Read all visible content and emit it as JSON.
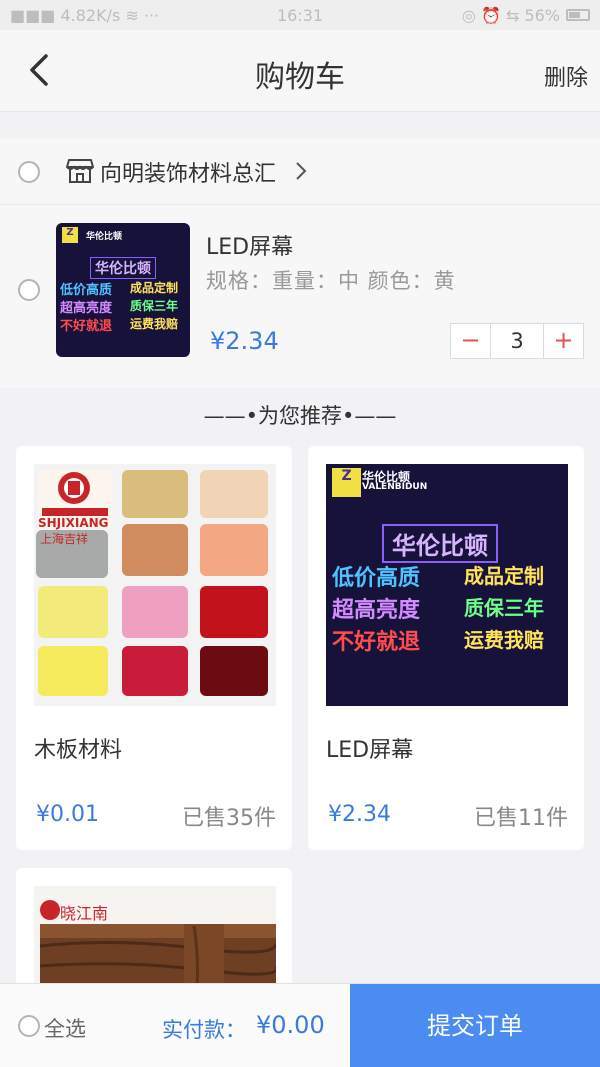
{
  "statusbar": {
    "left": "■■■ 4.82K/s ≋ ···",
    "time": "16:31",
    "right": "◎ ⏰ ⇆ 56%"
  },
  "nav": {
    "title": "购物车",
    "delete_label": "删除"
  },
  "shop": {
    "name": "向明装饰材料总汇"
  },
  "cart_item": {
    "name": "LED屏幕",
    "spec": "规格：重量：中  颜色：黄",
    "price": "¥2.34",
    "quantity": "3",
    "minus": "−",
    "plus": "+"
  },
  "recommend": {
    "title": "——•为您推荐•——",
    "cards": [
      {
        "name": "木板材料",
        "price": "¥0.01",
        "sold": "已售35件"
      },
      {
        "name": "LED屏幕",
        "price": "¥2.34",
        "sold": "已售11件"
      }
    ]
  },
  "led_image": {
    "brand": "华伦比顿",
    "brand_sub": "VALENBIDUN",
    "lines": [
      "低价高质",
      "成品定制",
      "超高亮度",
      "质保三年",
      "不好就退",
      "运费我赔"
    ]
  },
  "panel_image": {
    "brand": "上海吉祥",
    "brand_en": "SHJIXIANG"
  },
  "wood_image": {
    "brand": "晓江南"
  },
  "bottom": {
    "select_all": "全选",
    "total_label": "实付款：",
    "total_value": "¥0.00",
    "submit": "提交订单"
  },
  "colors": {
    "accent": "#3a7ae0",
    "submit_bg": "#4a8cf0"
  }
}
